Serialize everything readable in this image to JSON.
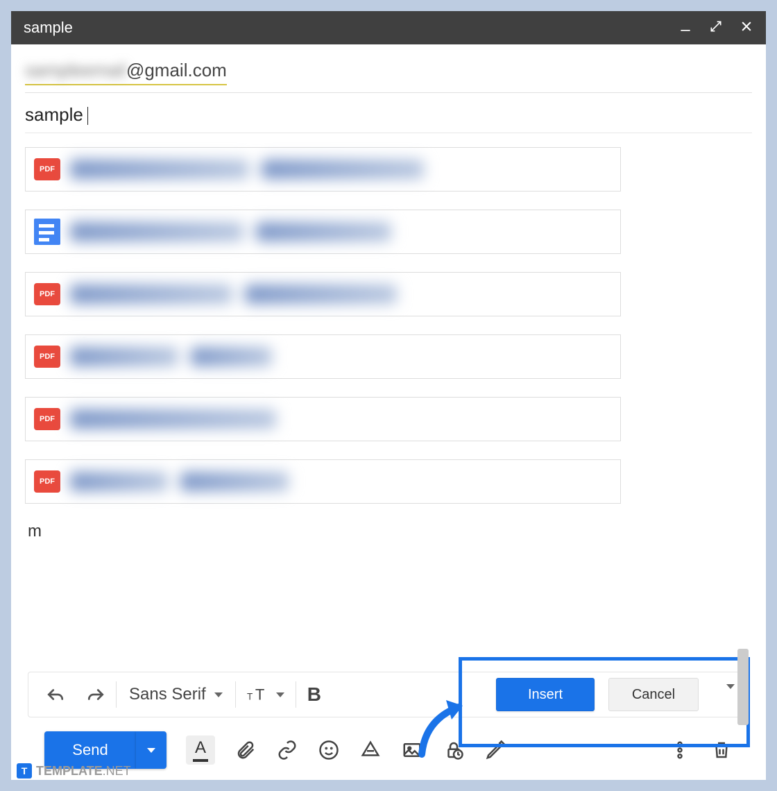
{
  "window": {
    "title": "sample"
  },
  "to": {
    "redacted_prefix": "sampleemail",
    "domain": "@gmail.com"
  },
  "subject": "sample",
  "attachments": [
    {
      "type": "pdf",
      "badge": "PDF"
    },
    {
      "type": "doc",
      "badge": ""
    },
    {
      "type": "pdf",
      "badge": "PDF"
    },
    {
      "type": "pdf",
      "badge": "PDF"
    },
    {
      "type": "pdf",
      "badge": "PDF"
    },
    {
      "type": "pdf",
      "badge": "PDF"
    }
  ],
  "body_text": "m",
  "format": {
    "font_label": "Sans Serif"
  },
  "dialog": {
    "insert_label": "Insert",
    "cancel_label": "Cancel"
  },
  "send": {
    "label": "Send"
  },
  "watermark": {
    "brand_bold": "TEMPLATE",
    "brand_light": ".NET"
  }
}
